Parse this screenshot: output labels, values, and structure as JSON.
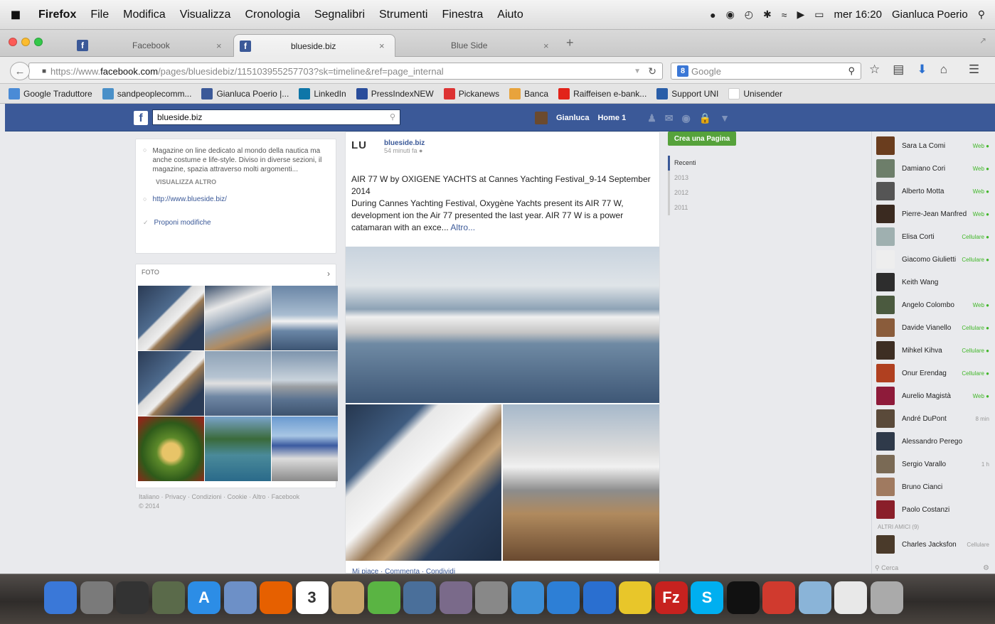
{
  "menubar": {
    "apple": "",
    "items": [
      "Firefox",
      "File",
      "Modifica",
      "Visualizza",
      "Cronologia",
      "Segnalibri",
      "Strumenti",
      "Finestra",
      "Aiuto"
    ],
    "clock": "mer 16:20",
    "user": "Gianluca Poerio"
  },
  "tabs": [
    {
      "label": "Facebook"
    },
    {
      "label": "blueside.biz"
    },
    {
      "label": "Blue Side"
    }
  ],
  "nav": {
    "url_prefix": "https://www.",
    "url_domain": "facebook.com",
    "url_rest": "/pages/bluesidebiz/115103955257703?sk=timeline&ref=page_internal",
    "search_placeholder": "Google"
  },
  "bookmarks": [
    {
      "label": "Google Traduttore",
      "color": "#4a8bd6"
    },
    {
      "label": "sandpeoplecomm...",
      "color": "#4a90c8"
    },
    {
      "label": "Gianluca Poerio |...",
      "color": "#3b5998"
    },
    {
      "label": "LinkedIn",
      "color": "#0e76a8"
    },
    {
      "label": "PressIndexNEW",
      "color": "#2a4d9b"
    },
    {
      "label": "Pickanews",
      "color": "#d33"
    },
    {
      "label": "Banca",
      "color": "#e8a33c"
    },
    {
      "label": "Raiffeisen e-bank...",
      "color": "#e2231a"
    },
    {
      "label": "Support UNI",
      "color": "#2a5ea8"
    },
    {
      "label": "Unisender",
      "color": "#ffffff"
    }
  ],
  "fb": {
    "search_value": "blueside.biz",
    "user_name": "Gianluca",
    "home_label": "Home",
    "home_count": "1"
  },
  "about": {
    "description": "Magazine on line dedicato al mondo della nautica ma anche costume e life-style. Diviso in diverse sezioni, il magazine, spazia attraverso molti argomenti...",
    "view_more": "VISUALIZZA ALTRO",
    "website": "http://www.blueside.biz/",
    "suggest": "Proponi modifiche"
  },
  "photos": {
    "title": "FOTO"
  },
  "footer": "Italiano · Privacy · Condizioni · Cookie · Altro · Facebook © 2014",
  "post": {
    "logo": "LU",
    "page_name": "blueside.biz",
    "time": "54 minuti fa",
    "title": "AIR 77 W by OXIGENE YACHTS at Cannes Yachting Festival_9-14 September 2014",
    "body": "During Cannes Yachting Festival, Oxygène Yachts present its AIR 77 W, development ion the Air 77 presented the last year. AIR 77 W is a power catamaran with an exce...",
    "more": "Altro...",
    "actions": "Mi piace · Commenta · Condividi"
  },
  "timeline": {
    "create_page": "Crea una Pagina",
    "years": [
      "Recenti",
      "2013",
      "2012",
      "2011"
    ]
  },
  "chat": {
    "friends": [
      {
        "name": "Sara La Comi",
        "status": "Web",
        "color": "#6a3d1e"
      },
      {
        "name": "Damiano Cori",
        "status": "Web",
        "color": "#6d7e6a"
      },
      {
        "name": "Alberto Motta",
        "status": "Web",
        "color": "#555"
      },
      {
        "name": "Pierre-Jean Manfred",
        "status": "Web",
        "color": "#3a2a20"
      },
      {
        "name": "Elisa Corti",
        "status": "Cellulare",
        "color": "#9fb0b0"
      },
      {
        "name": "Giacomo Giulietti",
        "status": "Cellulare",
        "color": "#eee"
      },
      {
        "name": "Keith Wang",
        "status": "",
        "color": "#2d2d2d"
      },
      {
        "name": "Angelo Colombo",
        "status": "Web",
        "color": "#4b5a3f"
      },
      {
        "name": "Davide Vianello",
        "status": "Cellulare",
        "color": "#8a5c3b"
      },
      {
        "name": "Mihkel Kihva",
        "status": "Cellulare",
        "color": "#3d2e23"
      },
      {
        "name": "Onur Erendag",
        "status": "Cellulare",
        "color": "#b04020"
      },
      {
        "name": "Aurelio Magistà",
        "status": "Web",
        "color": "#8e1b3a"
      },
      {
        "name": "André DuPont",
        "status": "8 min",
        "color": "#5a4a3a"
      },
      {
        "name": "Alessandro Perego",
        "status": "",
        "color": "#2f3a4a"
      },
      {
        "name": "Sergio Varallo",
        "status": "1 h",
        "color": "#7a6a55"
      },
      {
        "name": "Bruno Cianci",
        "status": "",
        "color": "#a07a60"
      },
      {
        "name": "Paolo Costanzi",
        "status": "",
        "color": "#8a1f2a"
      }
    ],
    "other_section": "ALTRI AMICI (9)",
    "other_friend": {
      "name": "Charles Jacksfon",
      "status": "Cellulare",
      "color": "#4a3a2a"
    },
    "search": "Cerca"
  },
  "dock": [
    {
      "name": "finder-icon",
      "color": "#3a78d8",
      "glyph": ""
    },
    {
      "name": "launchpad-icon",
      "color": "#7a7a7a",
      "glyph": ""
    },
    {
      "name": "dashboard-icon",
      "color": "#333",
      "glyph": ""
    },
    {
      "name": "mission-control-icon",
      "color": "#5a6a4a",
      "glyph": ""
    },
    {
      "name": "app-store-icon",
      "color": "#2c8de6",
      "glyph": "A"
    },
    {
      "name": "preview-icon",
      "color": "#6d90c7",
      "glyph": ""
    },
    {
      "name": "firefox-icon",
      "color": "#e66000",
      "glyph": ""
    },
    {
      "name": "calendar-icon",
      "color": "#fff",
      "glyph": "3"
    },
    {
      "name": "contacts-icon",
      "color": "#c9a46a",
      "glyph": ""
    },
    {
      "name": "evernote-icon",
      "color": "#5ab443",
      "glyph": ""
    },
    {
      "name": "iphoto-icon",
      "color": "#4a6f9a",
      "glyph": ""
    },
    {
      "name": "photo-booth-icon",
      "color": "#7a6a8a",
      "glyph": ""
    },
    {
      "name": "system-preferences-icon",
      "color": "#888",
      "glyph": ""
    },
    {
      "name": "mail-icon",
      "color": "#3c8fd8",
      "glyph": ""
    },
    {
      "name": "safari-icon",
      "color": "#2d7fd6",
      "glyph": ""
    },
    {
      "name": "itunes-icon",
      "color": "#2a6fd0",
      "glyph": ""
    },
    {
      "name": "cyberduck-icon",
      "color": "#e8c62a",
      "glyph": ""
    },
    {
      "name": "filezilla-icon",
      "color": "#c7221f",
      "glyph": "Fz"
    },
    {
      "name": "skype-icon",
      "color": "#00aff0",
      "glyph": "S"
    },
    {
      "name": "blackberry-icon",
      "color": "#111",
      "glyph": ""
    },
    {
      "name": "mail-app-icon",
      "color": "#d03a2e",
      "glyph": ""
    },
    {
      "name": "folder-icon",
      "color": "#8ab4d8",
      "glyph": ""
    },
    {
      "name": "document-icon",
      "color": "#e8e8e8",
      "glyph": ""
    },
    {
      "name": "trash-icon",
      "color": "#aaa",
      "glyph": ""
    }
  ]
}
